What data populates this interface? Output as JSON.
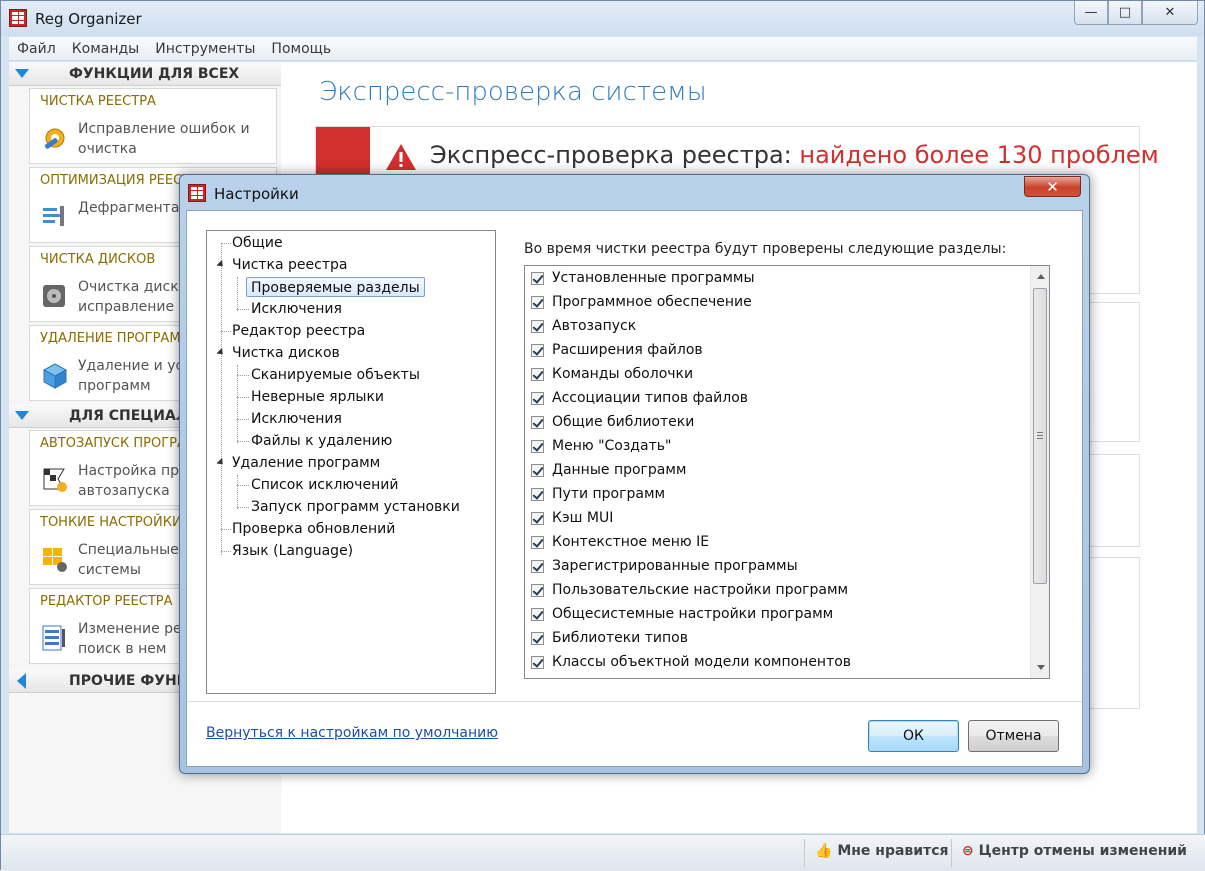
{
  "app": {
    "title": "Reg Organizer"
  },
  "window_controls": {
    "min": "—",
    "max": "□",
    "close": "✕"
  },
  "menu": [
    "Файл",
    "Команды",
    "Инструменты",
    "Помощь"
  ],
  "sidebar": {
    "group1": "ФУНКЦИИ ДЛЯ ВСЕХ",
    "group2": "ДЛЯ СПЕЦИАЛИСТОВ",
    "group3": "ПРОЧИЕ ФУНКЦИИ",
    "cards": [
      {
        "title": "ЧИСТКА РЕЕСТРА",
        "desc": "Исправление ошибок и очистка",
        "icon": "registry-clean-icon"
      },
      {
        "title": "ОПТИМИЗАЦИЯ РЕЕСТРА",
        "desc": "Дефрагментация реестра",
        "icon": "defrag-icon"
      },
      {
        "title": "ЧИСТКА ДИСКОВ",
        "desc": "Очистка дисков, исправление п",
        "icon": "disk-clean-icon"
      },
      {
        "title": "УДАЛЕНИЕ ПРОГРАММ",
        "desc": "Удаление и установка программ",
        "icon": "uninstall-icon"
      },
      {
        "title": "АВТОЗАПУСК ПРОГРАММ",
        "desc": "Настройка программ автозапуска",
        "icon": "autorun-icon"
      },
      {
        "title": "ТОНКИЕ НАСТРОЙКИ",
        "desc": "Специальные настройки системы",
        "icon": "tweaks-icon"
      },
      {
        "title": "РЕДАКТОР РЕЕСТРА",
        "desc": "Изменение реестра, поиск в нем",
        "icon": "regedit-icon"
      }
    ]
  },
  "main": {
    "title": "Экспресс-проверка системы",
    "headline_prefix": "Экспресс-проверка реестра: ",
    "headline_result": "найдено более 130 проблем"
  },
  "status_bar": {
    "like": "Мне нравится",
    "undo_center": "Центр отмены изменений"
  },
  "dialog": {
    "title": "Настройки",
    "close": "✕",
    "tree": [
      {
        "label": "Общие",
        "level": 0
      },
      {
        "label": "Чистка реестра",
        "level": 0,
        "expanded": true
      },
      {
        "label": "Проверяемые разделы",
        "level": 1,
        "selected": true
      },
      {
        "label": "Исключения",
        "level": 1
      },
      {
        "label": "Редактор реестра",
        "level": 0
      },
      {
        "label": "Чистка дисков",
        "level": 0,
        "expanded": true
      },
      {
        "label": "Сканируемые объекты",
        "level": 1
      },
      {
        "label": "Неверные ярлыки",
        "level": 1
      },
      {
        "label": "Исключения",
        "level": 1
      },
      {
        "label": "Файлы к удалению",
        "level": 1
      },
      {
        "label": "Удаление программ",
        "level": 0,
        "expanded": true
      },
      {
        "label": "Список исключений",
        "level": 1
      },
      {
        "label": "Запуск программ установки",
        "level": 1
      },
      {
        "label": "Проверка обновлений",
        "level": 0
      },
      {
        "label": "Язык (Language)",
        "level": 0
      }
    ],
    "list_caption": "Во время чистки реестра будут проверены следующие разделы:",
    "items": [
      "Установленные программы",
      "Программное обеспечение",
      "Автозапуск",
      "Расширения файлов",
      "Команды оболочки",
      "Ассоциации типов файлов",
      "Общие библиотеки",
      "Меню \"Создать\"",
      "Данные программ",
      "Пути программ",
      "Кэш MUI",
      "Контекстное меню IE",
      "Зарегистрированные программы",
      "Пользовательские настройки программ",
      "Общесистемные настройки программ",
      "Библиотеки типов",
      "Классы объектной модели компонентов"
    ],
    "reset_link": "Вернуться к настройкам по умолчанию",
    "ok": "ОК",
    "cancel": "Отмена"
  }
}
